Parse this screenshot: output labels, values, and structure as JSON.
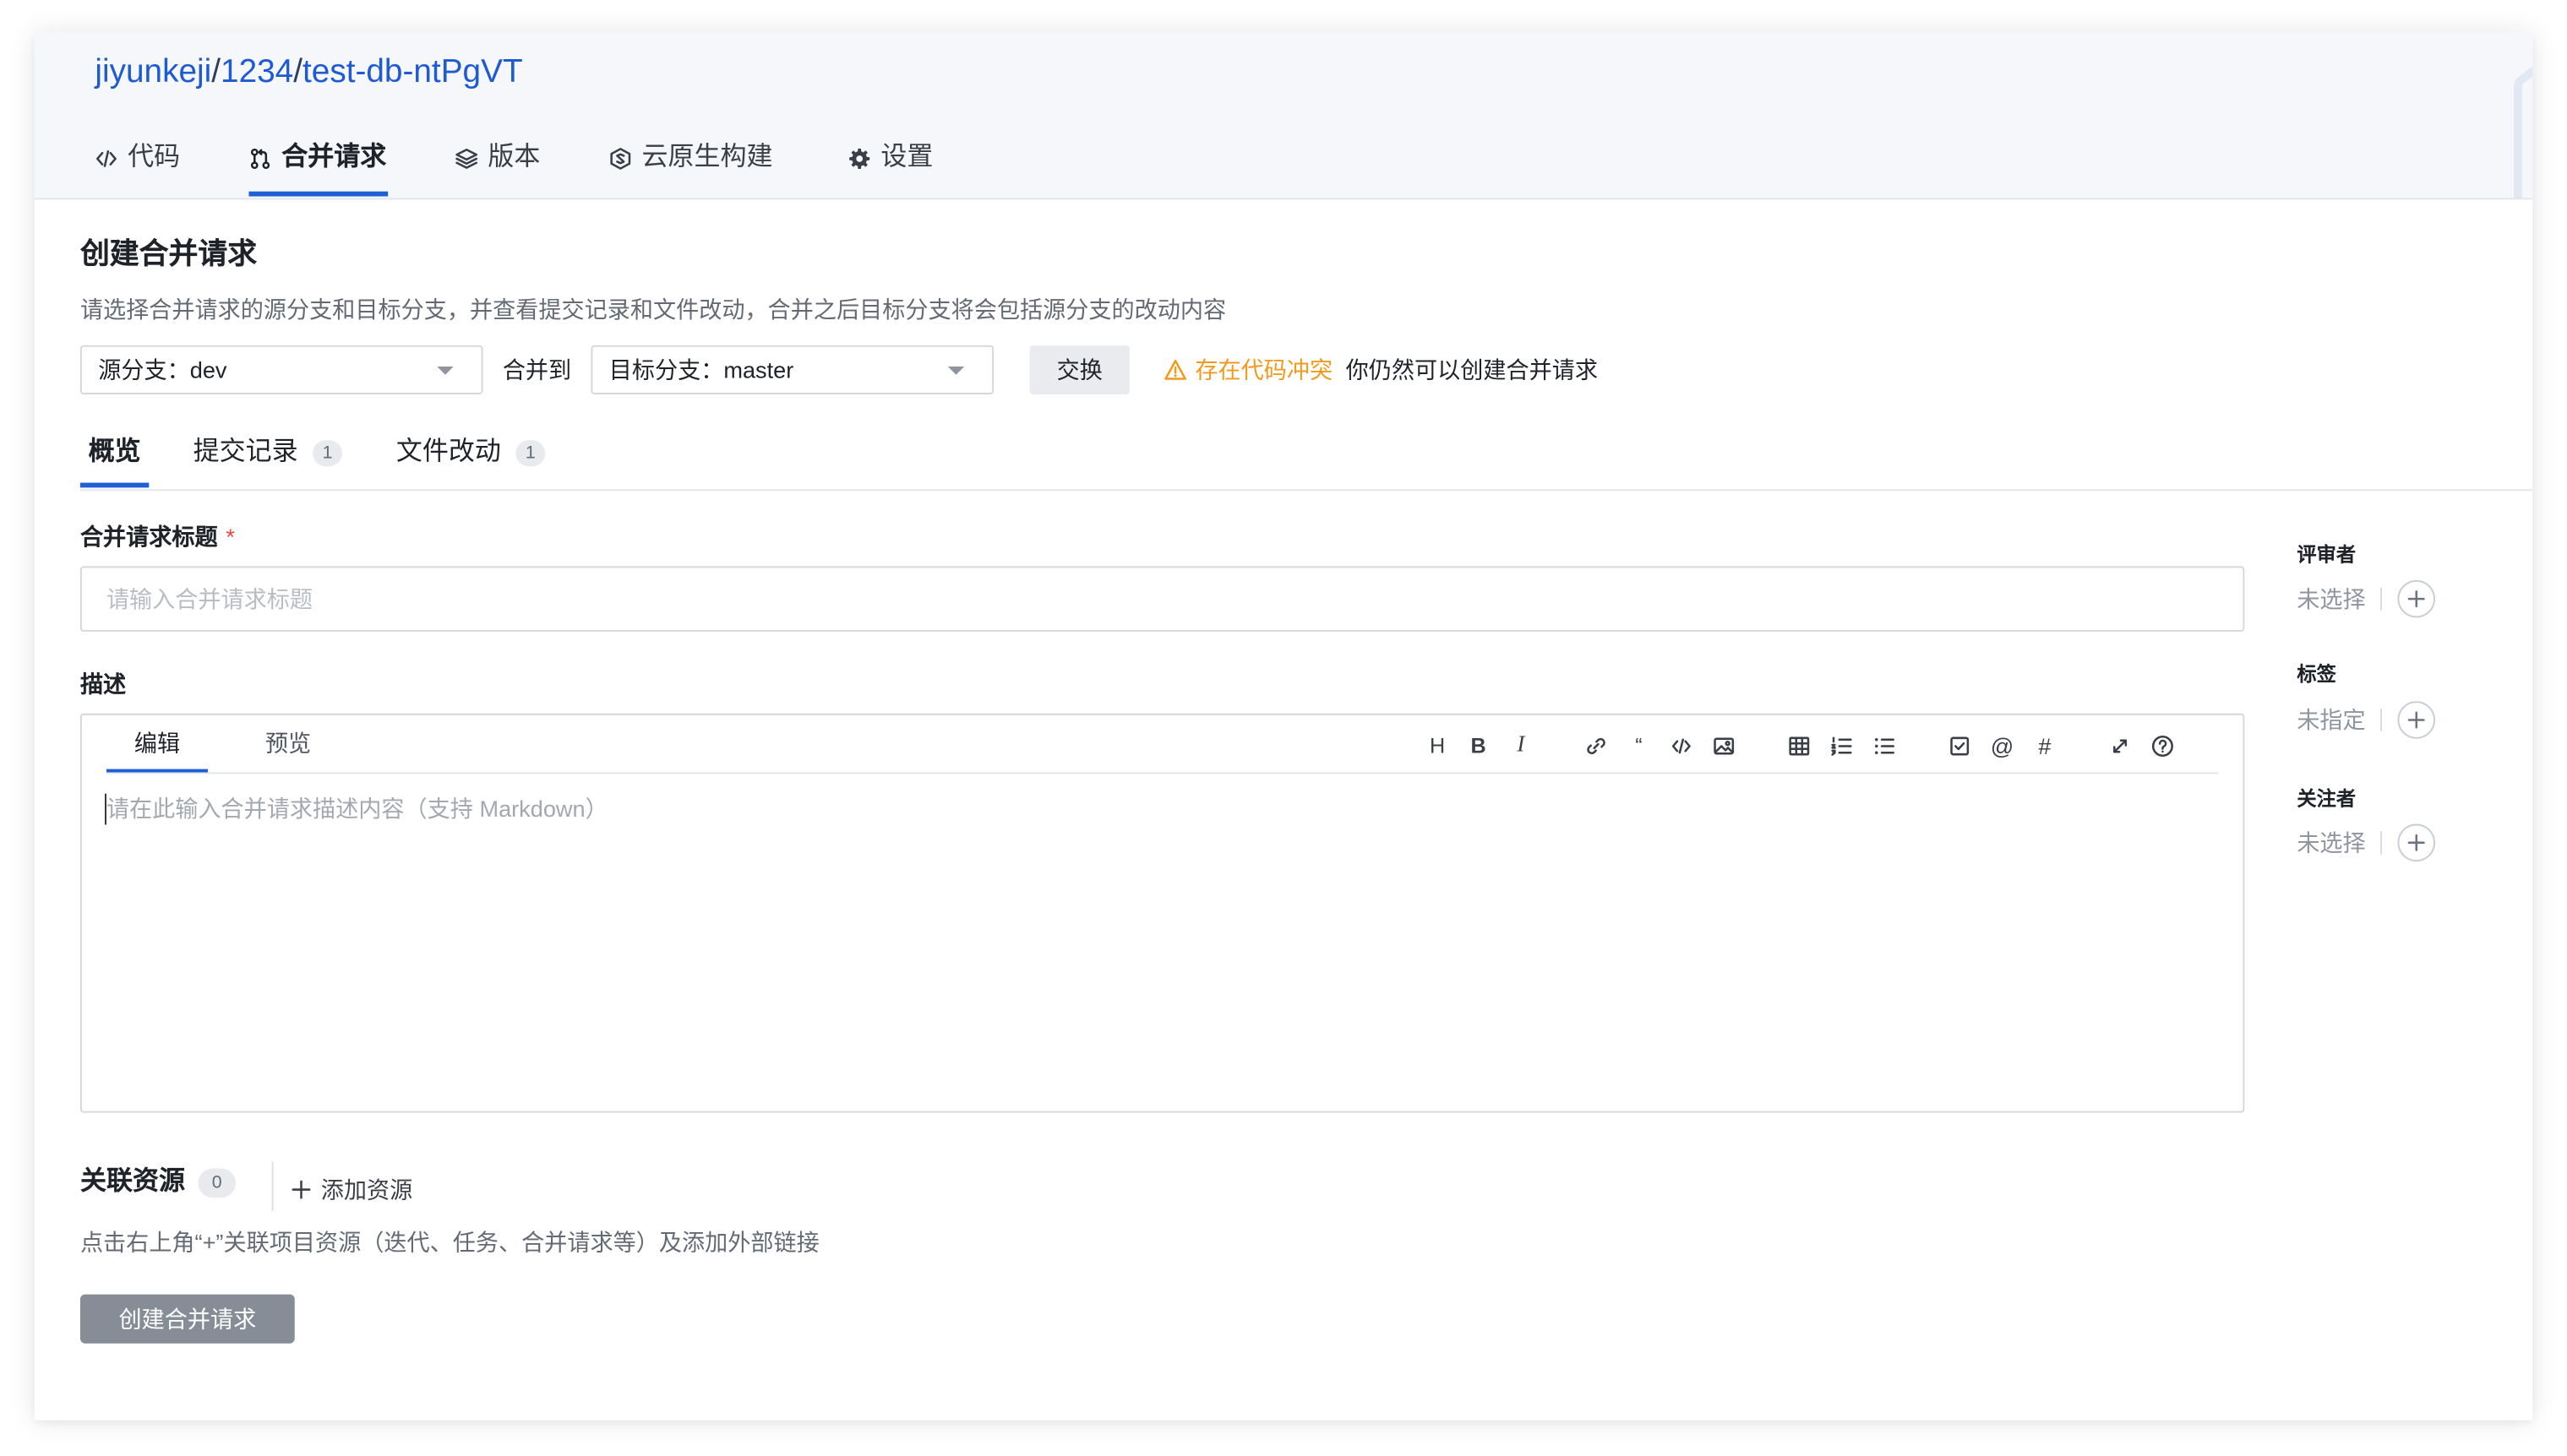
{
  "breadcrumb": {
    "org": "jiyunkeji",
    "separator": "/",
    "group": "1234",
    "repo": "test-db-ntPgVT"
  },
  "nav_tabs": [
    {
      "label": "代码",
      "icon": "code-icon",
      "active": false
    },
    {
      "label": "合并请求",
      "icon": "merge-request-icon",
      "active": true
    },
    {
      "label": "版本",
      "icon": "layers-icon",
      "active": false
    },
    {
      "label": "云原生构建",
      "icon": "cloud-native-build-icon",
      "active": false
    },
    {
      "label": "设置",
      "icon": "gear-icon",
      "active": false
    }
  ],
  "page": {
    "title": "创建合并请求",
    "subtitle": "请选择合并请求的源分支和目标分支，并查看提交记录和文件改动，合并之后目标分支将会包括源分支的改动内容"
  },
  "branches": {
    "source_prefix": "源分支：",
    "source_value": "dev",
    "merge_to_label": "合并到",
    "target_prefix": "目标分支：",
    "target_value": "master",
    "swap_label": "交换",
    "conflict_icon": "warning-icon",
    "conflict_text": "存在代码冲突",
    "conflict_note": "你仍然可以创建合并请求"
  },
  "content_tabs": [
    {
      "label": "概览",
      "active": true
    },
    {
      "label": "提交记录",
      "count": "1",
      "active": false
    },
    {
      "label": "文件改动",
      "count": "1",
      "active": false
    }
  ],
  "form": {
    "title_label": "合并请求标题",
    "required_mark": "*",
    "title_value": "",
    "title_placeholder": "请输入合并请求标题",
    "description_label": "描述",
    "editor_tabs": [
      {
        "label": "编辑",
        "active": true
      },
      {
        "label": "预览",
        "active": false
      }
    ],
    "description_value": "",
    "description_placeholder": "请在此输入合并请求描述内容（支持 Markdown）",
    "toolbar": [
      {
        "icon": "heading-icon",
        "glyph": "H"
      },
      {
        "icon": "bold-icon",
        "glyph": "B"
      },
      {
        "icon": "italic-icon",
        "glyph": "I"
      },
      {
        "icon": "link-icon"
      },
      {
        "icon": "quote-icon",
        "glyph": "“"
      },
      {
        "icon": "code-icon"
      },
      {
        "icon": "image-icon"
      },
      {
        "icon": "table-icon"
      },
      {
        "icon": "ordered-list-icon"
      },
      {
        "icon": "unordered-list-icon"
      },
      {
        "icon": "task-list-icon"
      },
      {
        "icon": "mention-icon",
        "glyph": "@"
      },
      {
        "icon": "hashtag-icon",
        "glyph": "#"
      },
      {
        "icon": "fullscreen-icon"
      },
      {
        "icon": "help-icon"
      }
    ]
  },
  "sidebar": [
    {
      "label": "评审者",
      "value": "未选择",
      "add_icon": "plus-circle-icon"
    },
    {
      "label": "标签",
      "value": "未指定",
      "add_icon": "plus-circle-icon"
    },
    {
      "label": "关注者",
      "value": "未选择",
      "add_icon": "plus-circle-icon"
    }
  ],
  "resources": {
    "label": "关联资源",
    "count": "0",
    "add_icon": "plus-icon",
    "add_label": "添加资源",
    "hint": "点击右上角“+”关联项目资源（迭代、任务、合并请求等）及添加外部链接"
  },
  "actions": {
    "submit_label": "创建合并请求"
  },
  "colors": {
    "accent": "#1f5fd6",
    "link": "#1d5ad4",
    "warning": "#f39a1e",
    "required": "#e5483f",
    "header_bg": "#f5f7fa",
    "submit_button_bg": "#878d96"
  }
}
